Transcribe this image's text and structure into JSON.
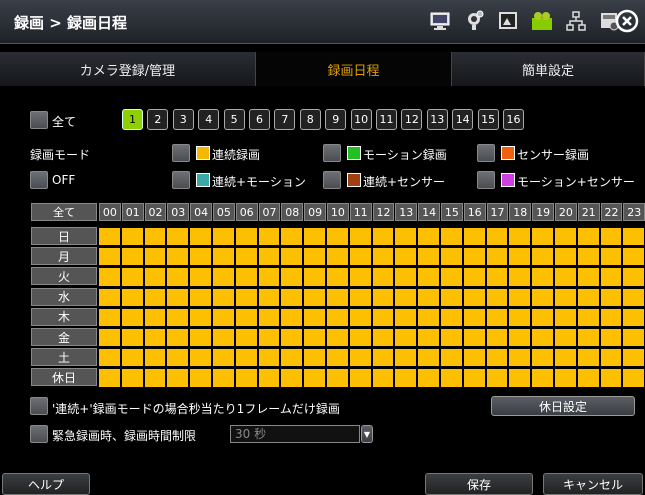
{
  "title": "録画 > 録画日程",
  "tabs": [
    {
      "label": "カメラ登録/管理"
    },
    {
      "label": "録画日程"
    },
    {
      "label": "簡単設定"
    }
  ],
  "all_label": "全て",
  "channels": [
    "1",
    "2",
    "3",
    "4",
    "5",
    "6",
    "7",
    "8",
    "9",
    "10",
    "11",
    "12",
    "13",
    "14",
    "15",
    "16"
  ],
  "selected_channel": "1",
  "mode": {
    "label": "録画モード",
    "off": "OFF",
    "items": [
      {
        "label": "連続録画",
        "color": "#f5b800"
      },
      {
        "label": "モーション録画",
        "color": "#22c022"
      },
      {
        "label": "センサー録画",
        "color": "#f06010"
      },
      {
        "label": "連続+モーション",
        "color": "#3aa8a8"
      },
      {
        "label": "連続+センサー",
        "color": "#a04010"
      },
      {
        "label": "モーション+センサー",
        "color": "#d040e0"
      }
    ]
  },
  "grid": {
    "all_label": "全て",
    "hours": [
      "00",
      "01",
      "02",
      "03",
      "04",
      "05",
      "06",
      "07",
      "08",
      "09",
      "10",
      "11",
      "12",
      "13",
      "14",
      "15",
      "16",
      "17",
      "18",
      "19",
      "20",
      "21",
      "22",
      "23"
    ],
    "days": [
      "日",
      "月",
      "火",
      "水",
      "木",
      "金",
      "土",
      "休日"
    ],
    "fill_color": "#fcc000"
  },
  "option1": "'連続+'録画モードの場合秒当たり1フレームだけ録画",
  "holiday_button": "休日設定",
  "option2": "緊急録画時、録画時間制限",
  "limit_value": "30 秒",
  "footer": {
    "help": "ヘルプ",
    "save": "保存",
    "cancel": "キャンセル"
  }
}
